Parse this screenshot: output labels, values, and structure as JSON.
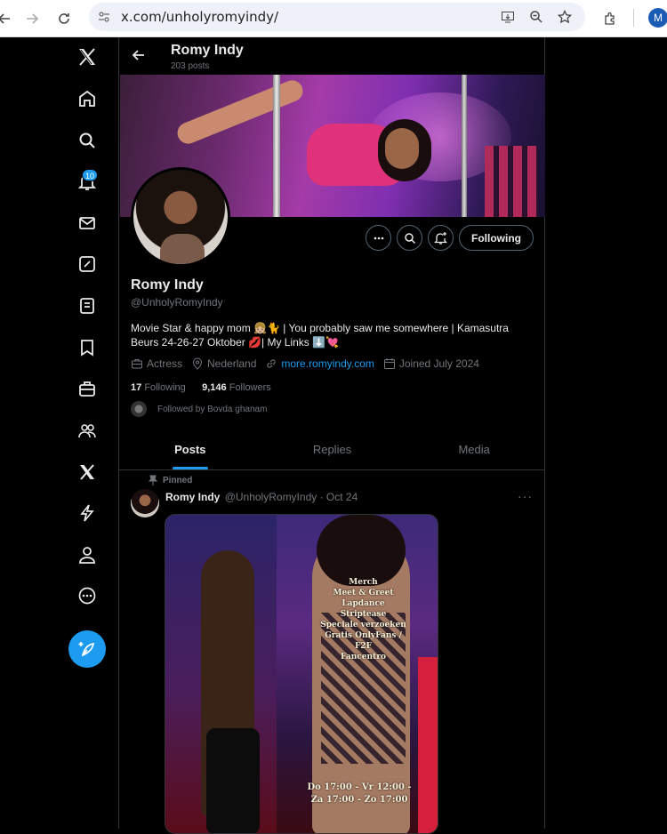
{
  "browser": {
    "url": "x.com/unholyromyindy/",
    "profile_initial": "M"
  },
  "nav": {
    "notifications_badge": "10",
    "icons": [
      "x-logo-icon",
      "home-icon",
      "search-icon",
      "notifications-icon",
      "messages-icon",
      "grok-icon",
      "lists-icon",
      "bookmarks-icon",
      "jobs-icon",
      "communities-icon",
      "premium-icon",
      "verified-orgs-icon",
      "profile-icon",
      "more-icon"
    ]
  },
  "header": {
    "name": "Romy Indy",
    "post_count": "203 posts"
  },
  "profile": {
    "name": "Romy Indy",
    "handle": "@UnholyRomyIndy",
    "bio": "Movie Star & happy mom 👧🏼🐈 | You probably saw me somewhere | Kamasutra Beurs 24-26-27 Oktober 💋| My Links ⬇️💘",
    "category": "Actress",
    "location": "Nederland",
    "website": "more.romyindy.com",
    "joined": "Joined July 2024",
    "following_count": "17",
    "following_label": "Following",
    "followers_count": "9,146",
    "followers_label": "Followers",
    "followed_by": "Followed by Bovda ghanam",
    "following_button": "Following"
  },
  "tabs": [
    "Posts",
    "Replies",
    "Media"
  ],
  "post": {
    "pinned_label": "Pinned",
    "author": "Romy Indy",
    "handle": "@UnholyRomyIndy",
    "date": "· Oct 24",
    "sign_lines": [
      "Merch",
      "Meet & Greet",
      "Lapdance",
      "Striptease",
      "Speciale verzoeken",
      "Gratis OnlyFans / F2F",
      "Fancentro"
    ],
    "schedule_lines": [
      "Do 17:00 - Vr 12:00 -",
      "Za 17:00 - Zo 17:00"
    ]
  },
  "colors": {
    "accent": "#1d9bf0",
    "background": "#000000",
    "text": "#e7e9ea",
    "muted": "#71767b"
  }
}
